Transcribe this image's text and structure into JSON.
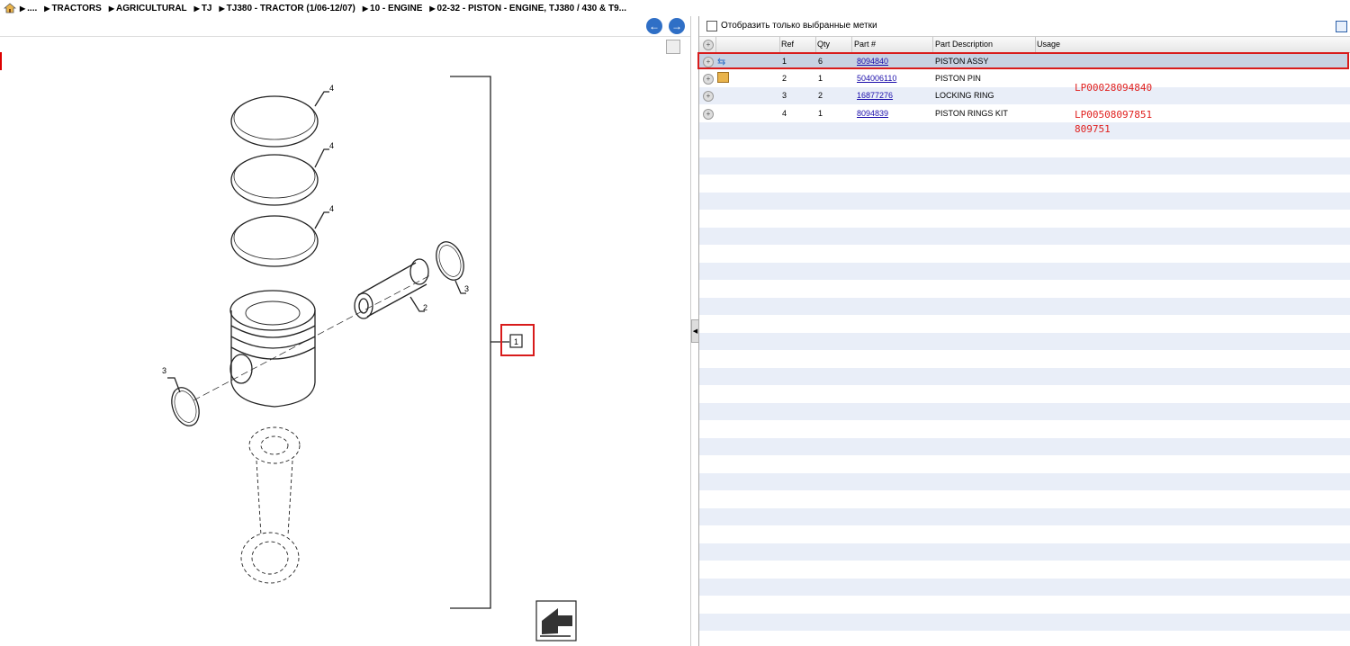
{
  "breadcrumb": [
    "....",
    "TRACTORS",
    "AGRICULTURAL",
    "TJ",
    "TJ380 - TRACTOR (1/06-12/07)",
    "10 - ENGINE",
    "02-32 - PISTON - ENGINE, TJ380 / 430 & T9..."
  ],
  "filter": {
    "label": "Отобразить только выбранные метки"
  },
  "table": {
    "headers": {
      "ref": "Ref",
      "qty": "Qty",
      "part": "Part #",
      "desc": "Part Description",
      "usage": "Usage"
    },
    "rows": [
      {
        "ref": "1",
        "qty": "6",
        "part": "8094840",
        "desc": "PISTON ASSY"
      },
      {
        "ref": "2",
        "qty": "1",
        "part": "504006110",
        "desc": "PISTON PIN"
      },
      {
        "ref": "3",
        "qty": "2",
        "part": "16877276",
        "desc": "LOCKING RING"
      },
      {
        "ref": "4",
        "qty": "1",
        "part": "8094839",
        "desc": "PISTON RINGS KIT"
      }
    ]
  },
  "notes": [
    "LP00028094840",
    "LP00508097851",
    "809751"
  ],
  "diagram": {
    "callouts": [
      "4",
      "4",
      "4",
      "3",
      "2",
      "3",
      "1"
    ]
  },
  "colors": {
    "accent": "#2f6fc6",
    "highlight": "#d81b1b",
    "note": "#e0201e"
  }
}
